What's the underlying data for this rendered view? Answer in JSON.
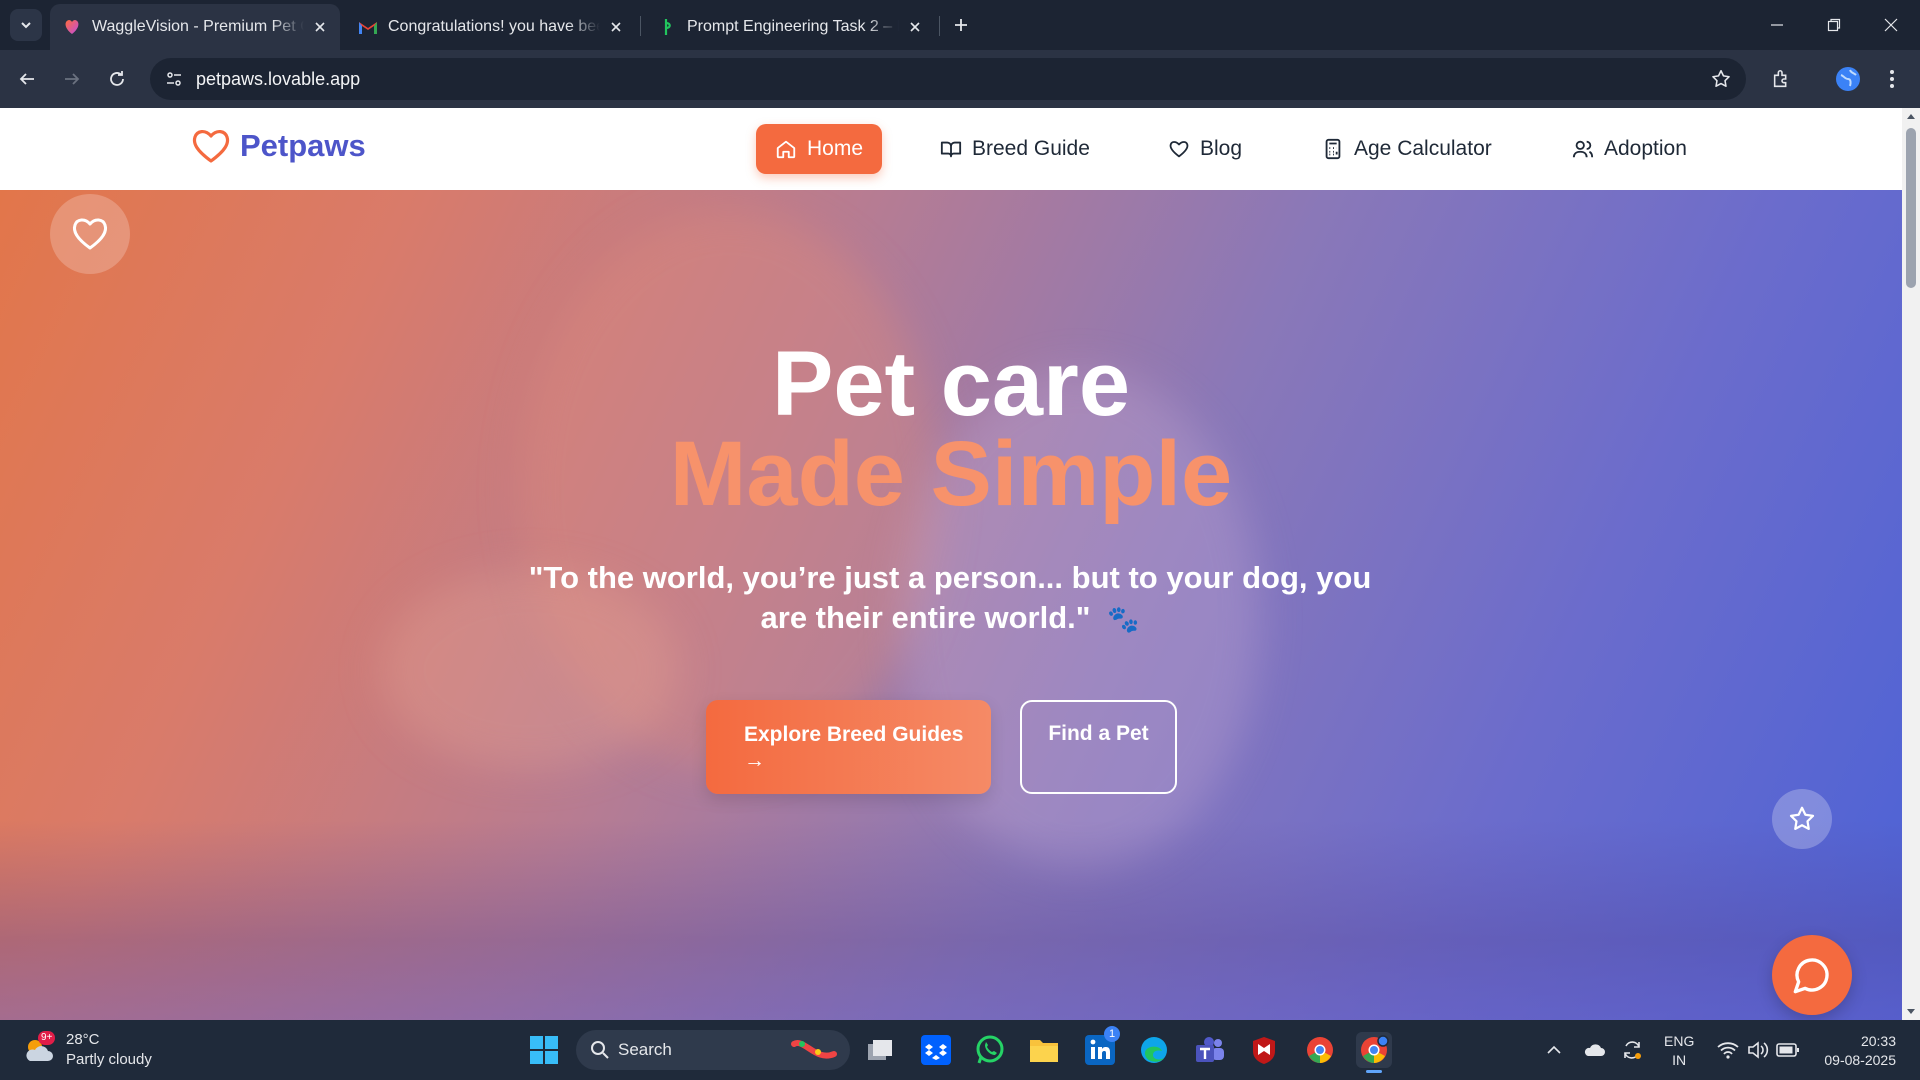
{
  "browser": {
    "tabs": [
      {
        "title": "WaggleVision - Premium Pet Care",
        "active": true
      },
      {
        "title": "Congratulations! you have been",
        "active": false
      },
      {
        "title": "Prompt Engineering Task 2 – Fu",
        "active": false
      }
    ],
    "url": "petpaws.lovable.app"
  },
  "site": {
    "brand": "Petpaws",
    "nav": {
      "home": "Home",
      "breed_guide": "Breed Guide",
      "blog": "Blog",
      "age_calculator": "Age Calculator",
      "adoption": "Adoption"
    },
    "hero": {
      "title_line1": "Pet care",
      "title_line2": "Made Simple",
      "quote": "\"To the world, you’re just a person... but to your dog, you are their entire world.\"",
      "quote_emoji": "🐾",
      "cta_primary": "Explore Breed Guides",
      "cta_primary_arrow": "→",
      "cta_secondary": "Find a Pet"
    },
    "colors": {
      "accent": "#f46a3f",
      "brand": "#4d55c9"
    }
  },
  "taskbar": {
    "weather_temp": "28°C",
    "weather_desc": "Partly cloudy",
    "weather_badge": "9+",
    "search_placeholder": "Search",
    "linkedin_badge": "1",
    "lang_line1": "ENG",
    "lang_line2": "IN",
    "time": "20:33",
    "date": "09-08-2025"
  }
}
